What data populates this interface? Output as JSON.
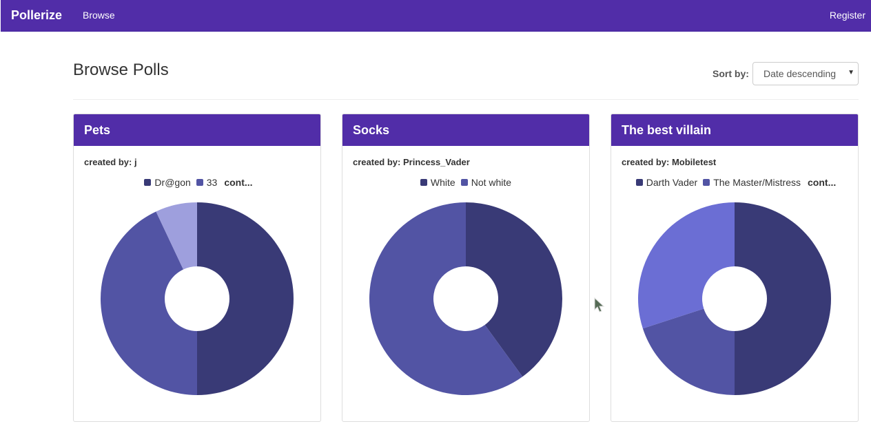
{
  "navbar": {
    "brand": "Pollerize",
    "browse": "Browse",
    "register": "Register"
  },
  "page": {
    "title": "Browse Polls",
    "sort_label": "Sort by:",
    "sort_value": "Date descending"
  },
  "colors": {
    "navbar": "#512da8",
    "slice1": "#393a76",
    "slice2": "#5254a4",
    "slice3a": "#9e9fdd",
    "slice3b": "#6b6ed4"
  },
  "polls": [
    {
      "title": "Pets",
      "creator_label": "created by: j",
      "legend": [
        "Dr@gon",
        "33"
      ],
      "more": "cont...",
      "chart_data": {
        "type": "pie",
        "donut": true,
        "values": [
          50,
          43,
          7
        ],
        "colors": [
          "#393a76",
          "#5254a4",
          "#9e9fdd"
        ]
      }
    },
    {
      "title": "Socks",
      "creator_label": "created by: Princess_Vader",
      "legend": [
        "White",
        "Not white"
      ],
      "more": "",
      "chart_data": {
        "type": "pie",
        "donut": true,
        "values": [
          40,
          60
        ],
        "colors": [
          "#393a76",
          "#5254a4"
        ]
      }
    },
    {
      "title": "The best villain",
      "creator_label": "created by: Mobiletest",
      "legend": [
        "Darth Vader",
        "The Master/Mistress"
      ],
      "more": "cont...",
      "chart_data": {
        "type": "pie",
        "donut": true,
        "values": [
          50,
          20,
          30
        ],
        "colors": [
          "#393a76",
          "#5254a4",
          "#6b6ed4"
        ]
      }
    }
  ]
}
